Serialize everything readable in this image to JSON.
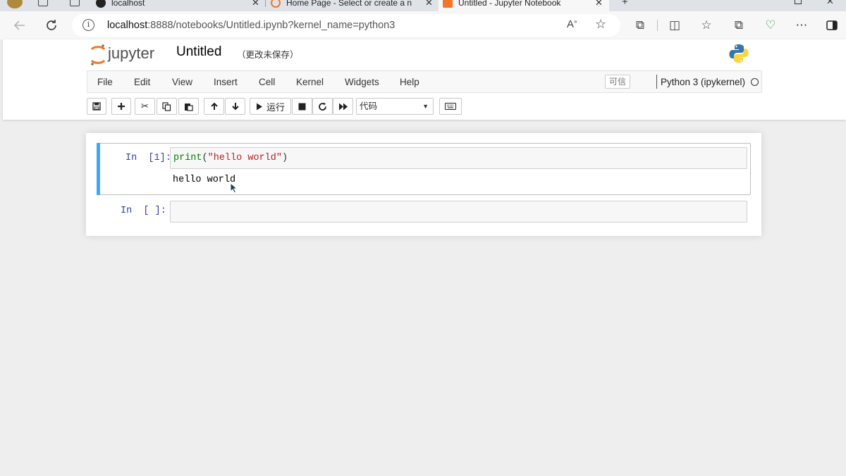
{
  "browser": {
    "tabs": [
      {
        "label": "localhost",
        "active": false
      },
      {
        "label": "Home Page - Select or create a n",
        "active": false
      },
      {
        "label": "Untitled - Jupyter Notebook",
        "active": true
      }
    ],
    "url_host": "localhost",
    "url_rest": ":8888/notebooks/Untitled.ipynb?kernel_name=python3"
  },
  "jupyter": {
    "logo_text": "jupyter",
    "notebook_title": "Untitled",
    "save_status": "（更改未保存）",
    "menu": [
      "File",
      "Edit",
      "View",
      "Insert",
      "Cell",
      "Kernel",
      "Widgets",
      "Help"
    ],
    "trusted_label": "可信",
    "kernel_name": "Python 3 (ipykernel)",
    "run_label": "运行",
    "cell_type": "代码"
  },
  "cells": [
    {
      "prompt": "In  [1]:",
      "code_func": "print",
      "code_open": "(",
      "code_string": "\"hello world\"",
      "code_close": ")",
      "output": "hello world"
    },
    {
      "prompt": "In  [ ]:",
      "code": ""
    }
  ],
  "colors": {
    "selected_cell_bar": "#42a5f5",
    "prompt_color": "#303f9f",
    "keyword_color": "#008000",
    "string_color": "#ba2121"
  }
}
